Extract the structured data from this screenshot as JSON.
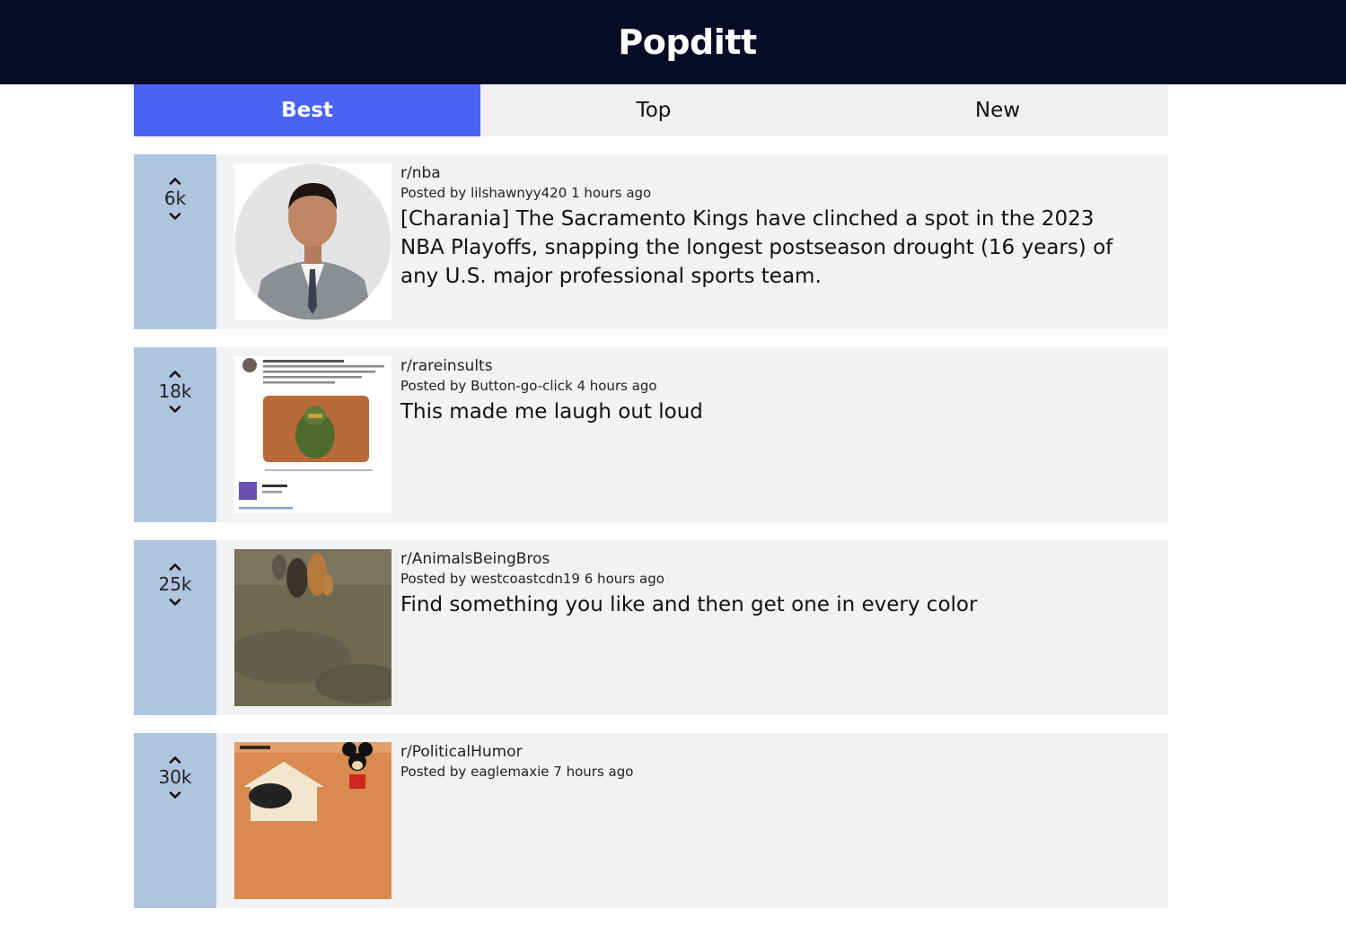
{
  "app": {
    "title": "Popditt"
  },
  "tabs": [
    {
      "label": "Best",
      "active": true
    },
    {
      "label": "Top",
      "active": false
    },
    {
      "label": "New",
      "active": false
    }
  ],
  "posts": [
    {
      "score": "6k",
      "subreddit": "r/nba",
      "author": "lilshawnyy420",
      "time": "1 hours ago",
      "title": "[Charania] The Sacramento Kings have clinched a spot in the 2023 NBA Playoffs, snapping the longest postseason drought (16 years) of any U.S. major professional sports team."
    },
    {
      "score": "18k",
      "subreddit": "r/rareinsults",
      "author": "Button-go-click",
      "time": "4 hours ago",
      "title": "This made me laugh out loud"
    },
    {
      "score": "25k",
      "subreddit": "r/AnimalsBeingBros",
      "author": "westcoastcdn19",
      "time": "6 hours ago",
      "title": "Find something you like and then get one in every color"
    },
    {
      "score": "30k",
      "subreddit": "r/PoliticalHumor",
      "author": "eaglemaxie",
      "time": "7 hours ago",
      "title": ""
    }
  ],
  "labels": {
    "posted_by": "Posted by"
  },
  "colors": {
    "header_bg": "#070b24",
    "tab_active": "#4a63f3",
    "vote_bg": "#afc4df",
    "card_bg": "#f2f3f5"
  },
  "icons": {
    "upvote": "chevron-up-icon",
    "downvote": "chevron-down-icon"
  }
}
